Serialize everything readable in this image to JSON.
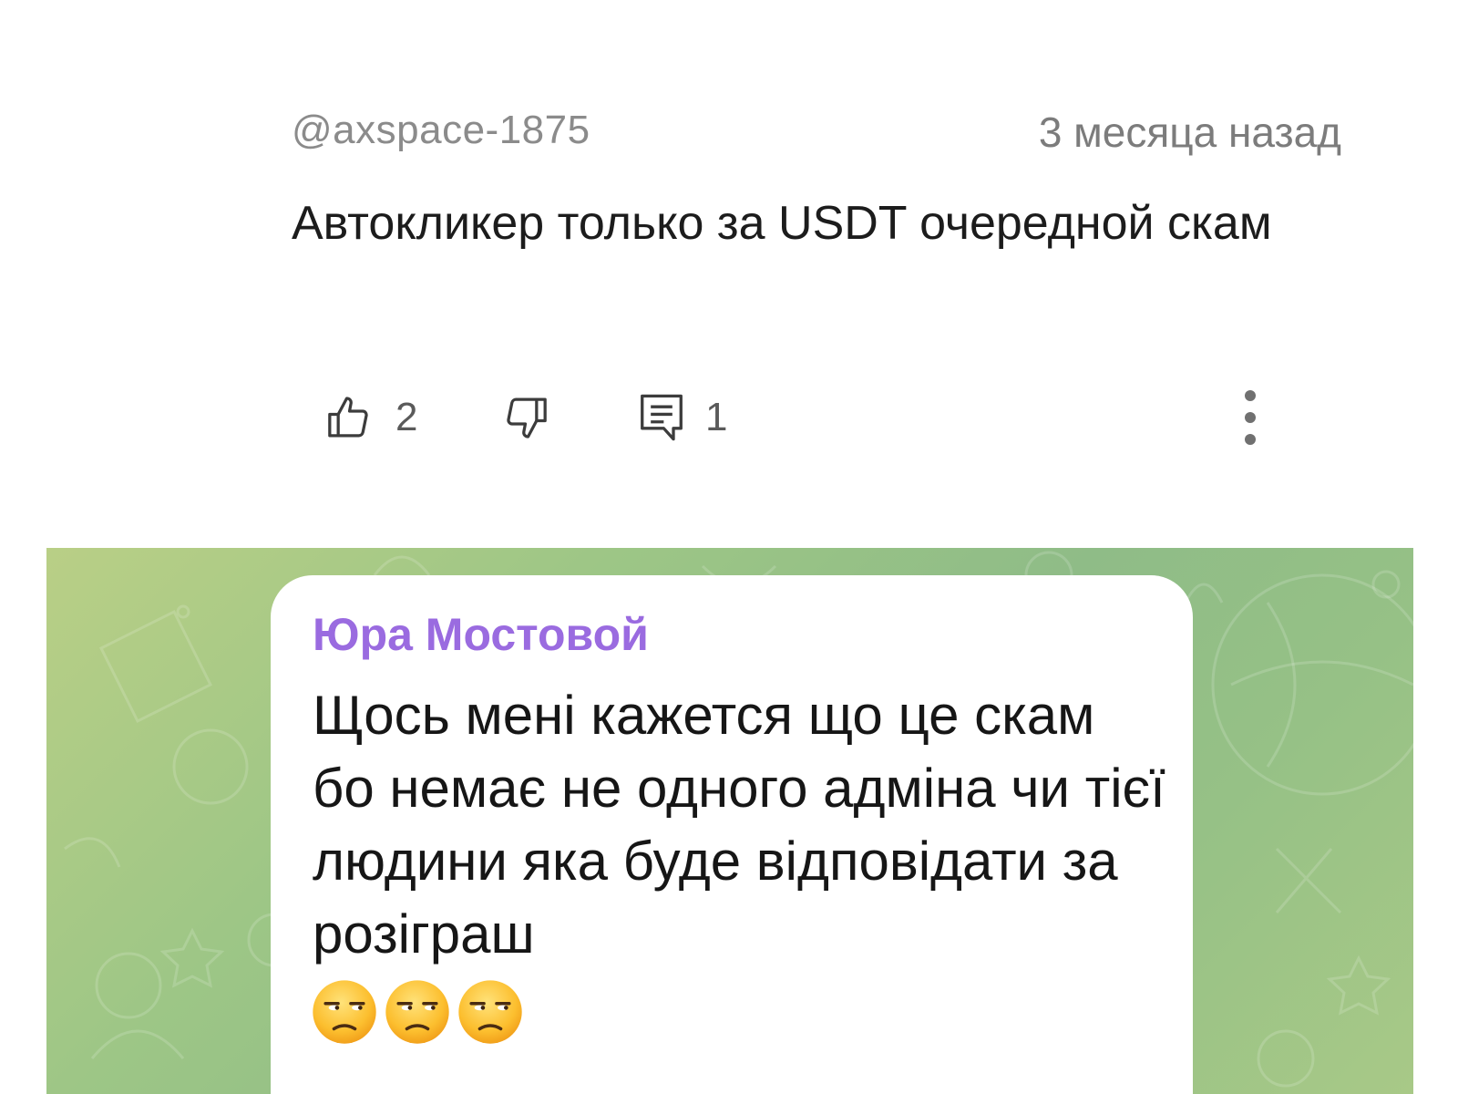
{
  "youtube_comment": {
    "author": "@axspace-1875",
    "timestamp": "3 месяца назад",
    "text": "Автокликер только за USDT очередной скам",
    "likes": "2",
    "replies": "1",
    "icons": {
      "like": "thumbs-up-icon",
      "dislike": "thumbs-down-icon",
      "reply": "reply-comment-icon",
      "more": "more-vertical-icon"
    }
  },
  "telegram_message": {
    "sender": "Юра Мостовой",
    "text": "Щось мені кажется що це скам бо немає не одного адміна чи тієї людини яка буде відповідати за розіграш",
    "emojis": [
      "unamused-face",
      "unamused-face",
      "unamused-face"
    ]
  },
  "colors": {
    "sender_name": "#9a6be0",
    "chat_background": "#9dc686",
    "muted_text": "#8b8b8b"
  }
}
